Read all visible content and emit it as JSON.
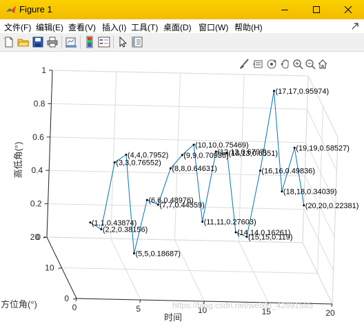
{
  "window": {
    "title": "Figure 1"
  },
  "menu": [
    "文件(F)",
    "编辑(E)",
    "查看(V)",
    "插入(I)",
    "工具(T)",
    "桌面(D)",
    "窗口(W)",
    "帮助(H)"
  ],
  "toolbar": {
    "icons": [
      "new-figure-icon",
      "open-file-icon",
      "save-icon",
      "print-icon",
      "link-plot-icon",
      "colorbar-icon",
      "legend-icon",
      "pointer-icon",
      "property-editor-icon"
    ]
  },
  "axes_toolbar": {
    "icons": [
      "brush-icon",
      "data-tips-icon",
      "rotate-3d-icon",
      "pan-icon",
      "zoom-in-icon",
      "zoom-out-icon",
      "home-icon"
    ]
  },
  "chart_data": {
    "type": "line",
    "xlabel": "时间",
    "ylabel": "方位角(°)",
    "zlabel": "高低角(°)",
    "xlim": [
      0,
      20
    ],
    "ylim": [
      0,
      20
    ],
    "zlim": [
      0,
      1
    ],
    "x_ticks": [
      "0",
      "5",
      "10",
      "15",
      "20"
    ],
    "y_ticks": [
      "0",
      "10",
      "20"
    ],
    "z_ticks": [
      "0",
      "0.2",
      "0.4",
      "0.6",
      "0.8",
      "1"
    ],
    "grid": true,
    "line_color": "#0072bd",
    "points": [
      {
        "x": 1,
        "y": 1,
        "z": 0.43874,
        "label": "(1,1,0.43874)"
      },
      {
        "x": 2,
        "y": 2,
        "z": 0.38156,
        "label": "(2,2,0.38156)"
      },
      {
        "x": 3,
        "y": 3,
        "z": 0.76552,
        "label": "(3,3,0.76552)"
      },
      {
        "x": 4,
        "y": 4,
        "z": 0.7952,
        "label": "(4,4,0.7952)"
      },
      {
        "x": 5,
        "y": 5,
        "z": 0.18687,
        "label": "(5,5,0.18687)"
      },
      {
        "x": 6,
        "y": 6,
        "z": 0.48976,
        "label": "(6,6,0.48976)"
      },
      {
        "x": 7,
        "y": 7,
        "z": 0.44559,
        "label": "(7,7,0.44559)"
      },
      {
        "x": 8,
        "y": 8,
        "z": 0.64631,
        "label": "(8,8,0.64631)"
      },
      {
        "x": 9,
        "y": 9,
        "z": 0.70936,
        "label": "(9,9,0.70936)"
      },
      {
        "x": 10,
        "y": 10,
        "z": 0.75469,
        "label": "(10,10,0.75469)"
      },
      {
        "x": 11,
        "y": 11,
        "z": 0.27603,
        "label": "(11,11,0.27603)"
      },
      {
        "x": 12,
        "y": 12,
        "z": 0.6797,
        "label": "(12,12,0.6797)"
      },
      {
        "x": 13,
        "y": 13,
        "z": 0.6551,
        "label": "(13,13,0.6551)"
      },
      {
        "x": 14,
        "y": 14,
        "z": 0.16261,
        "label": "(14,14,0.16261)"
      },
      {
        "x": 15,
        "y": 15,
        "z": 0.119,
        "label": "(15,15,0.119)"
      },
      {
        "x": 16,
        "y": 16,
        "z": 0.49836,
        "label": "(16,16,0.49836)"
      },
      {
        "x": 17,
        "y": 17,
        "z": 0.95974,
        "label": "(17,17,0.95974)"
      },
      {
        "x": 18,
        "y": 18,
        "z": 0.34039,
        "label": "(18,18,0.34039)"
      },
      {
        "x": 19,
        "y": 19,
        "z": 0.58527,
        "label": "(19,19,0.58527)"
      },
      {
        "x": 20,
        "y": 20,
        "z": 0.22381,
        "label": "(20,20,0.22381)"
      }
    ]
  },
  "watermark": "https://blog.csdn.net/weixin_42691585"
}
